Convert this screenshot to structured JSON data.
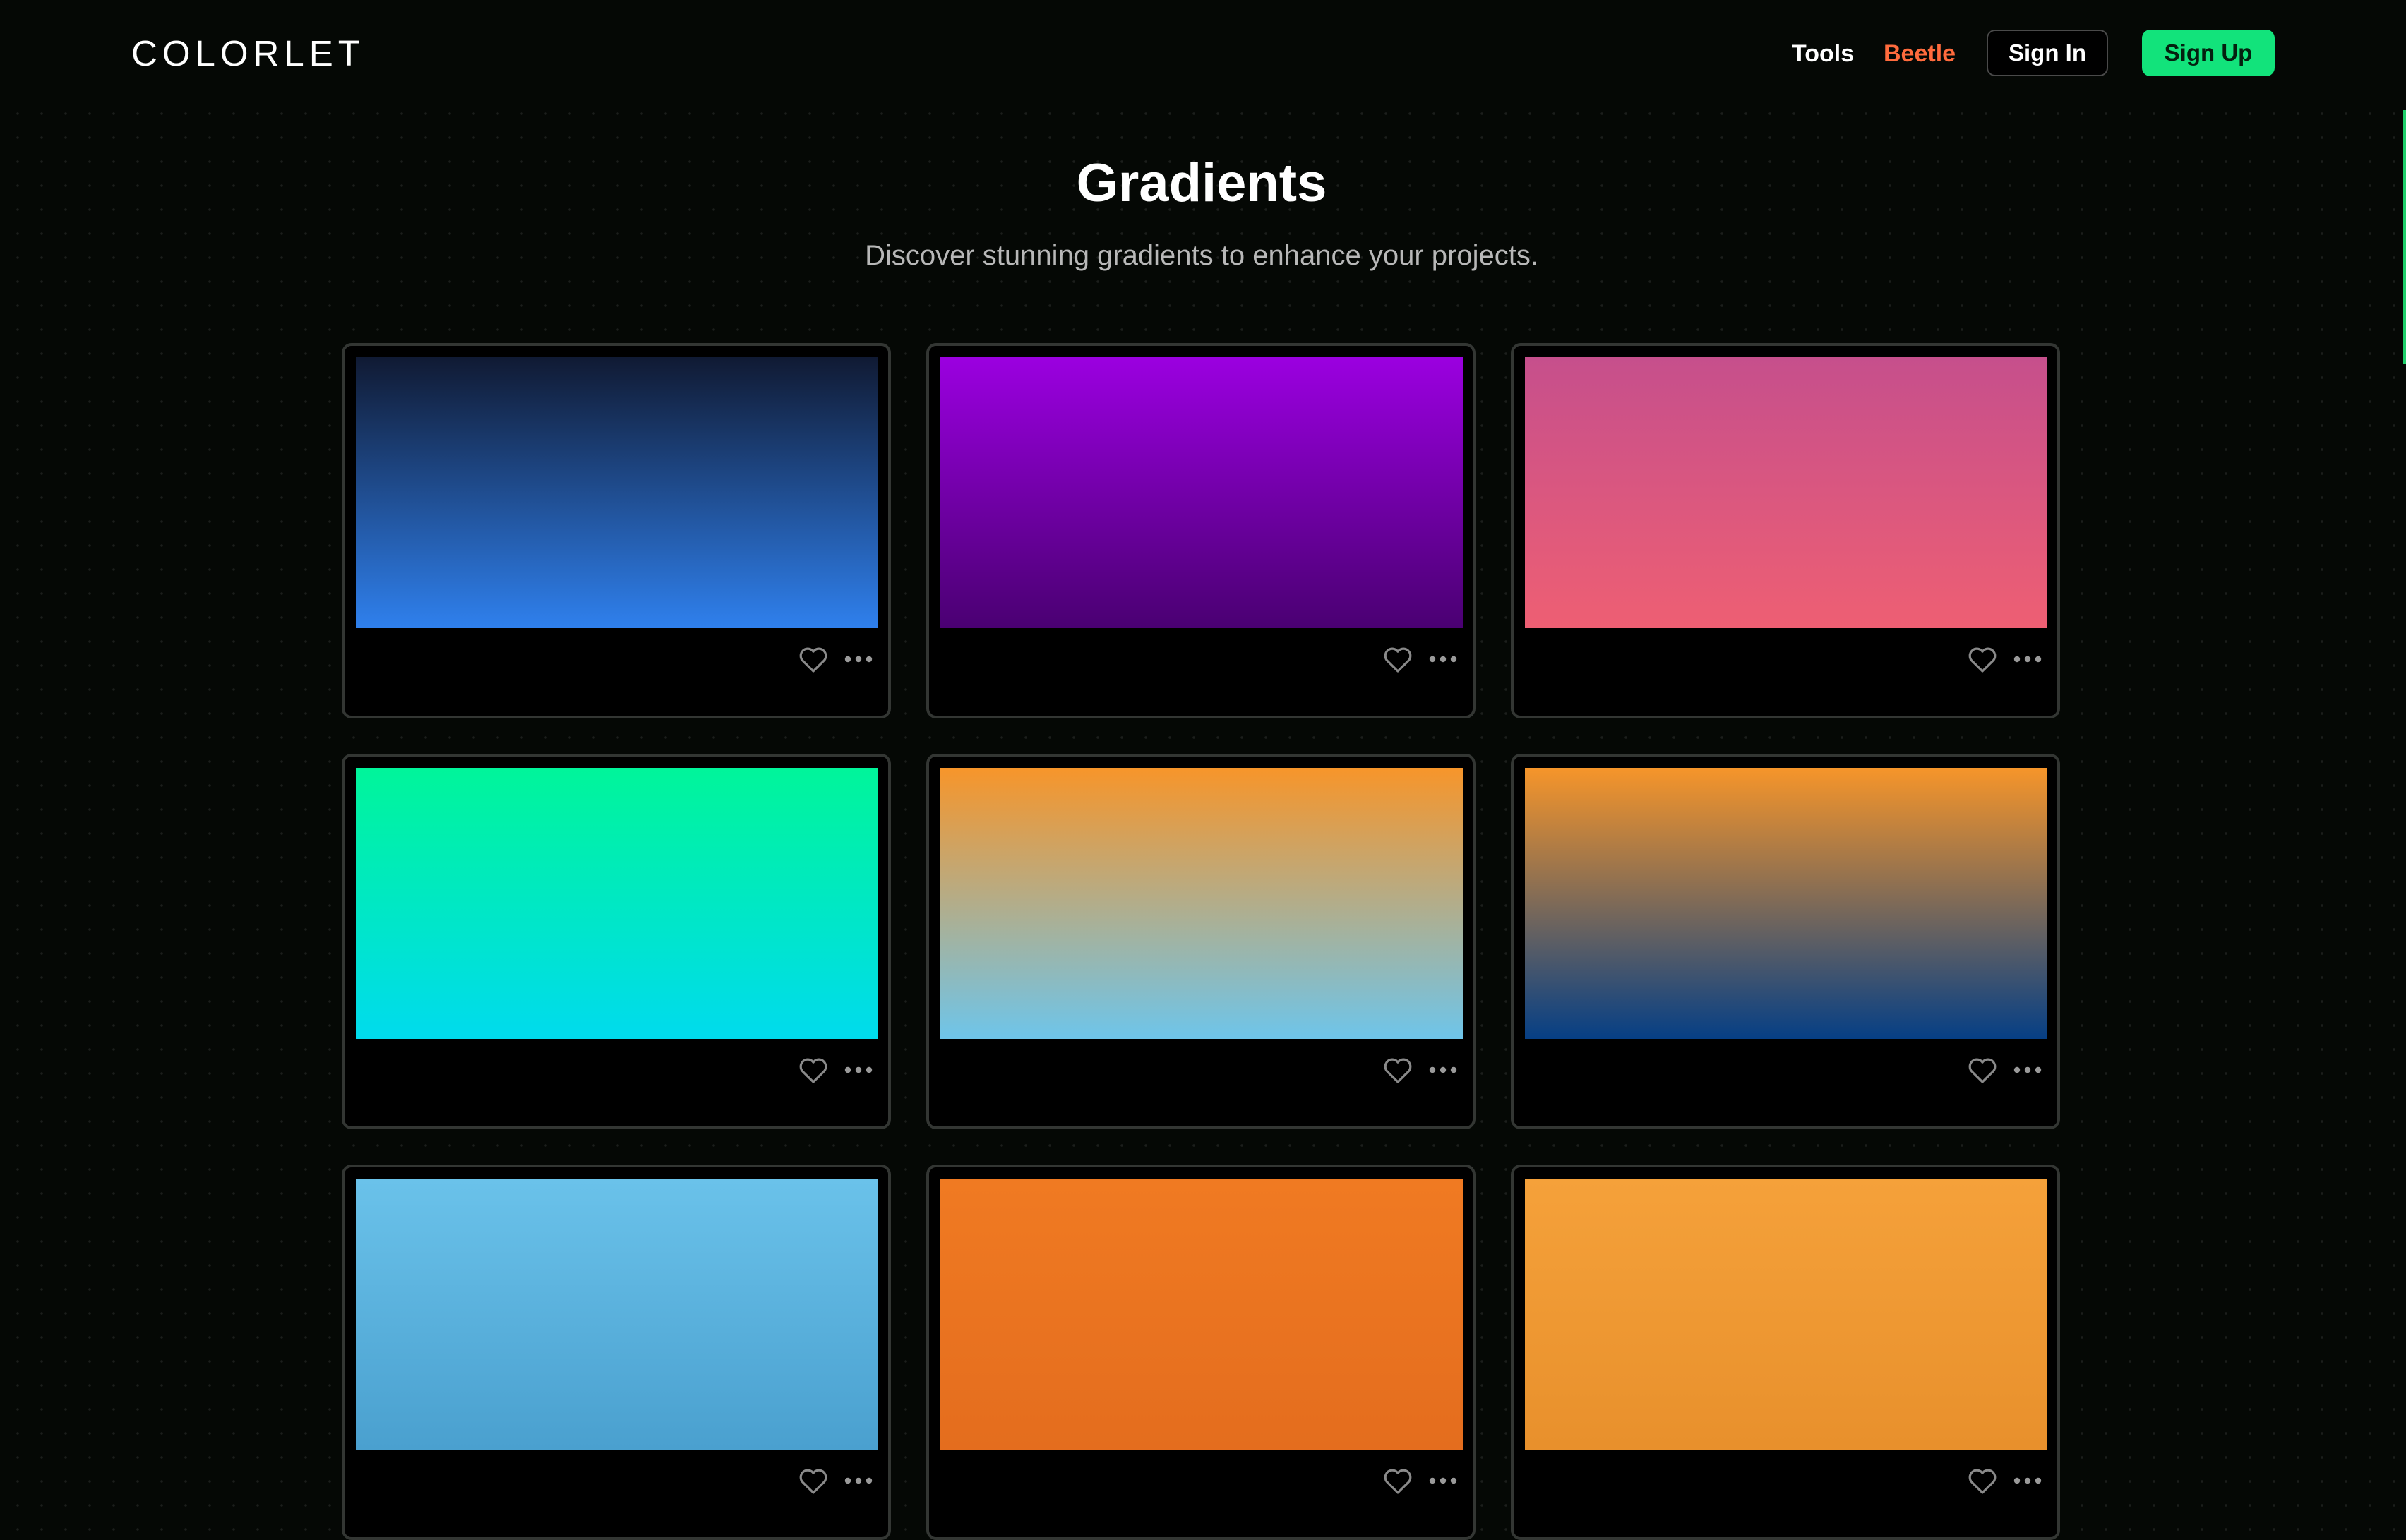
{
  "nav": {
    "logo": "COLORLET",
    "links": [
      {
        "label": "Tools"
      },
      {
        "label": "Beetle"
      }
    ],
    "sign_in": "Sign In",
    "sign_up": "Sign Up"
  },
  "header": {
    "title": "Gradients",
    "subtitle": "Discover stunning gradients to enhance your projects."
  },
  "colors": {
    "background": "#050805",
    "accent_green": "#12e37b",
    "beetle_orange": "#ff6b3d",
    "card_border": "#333633"
  },
  "cards": [
    {
      "from": "#101a33",
      "to": "#2f80ed"
    },
    {
      "from": "#9b00e0",
      "to": "#4a0072"
    },
    {
      "from": "#c64f8c",
      "to": "#ee5f73"
    },
    {
      "from": "#00f59a",
      "to": "#00dbed"
    },
    {
      "from": "#f7952a",
      "to": "#6ec5ea"
    },
    {
      "from": "#f6952a",
      "to": "#063f85"
    },
    {
      "from": "#6ac2ea",
      "to": "#4aa0cf"
    },
    {
      "from": "#f07a22",
      "to": "#e46d1e"
    },
    {
      "from": "#f5a13a",
      "to": "#e8902c"
    }
  ],
  "icons": {
    "like": "heart-icon",
    "more": "more-options-icon"
  }
}
